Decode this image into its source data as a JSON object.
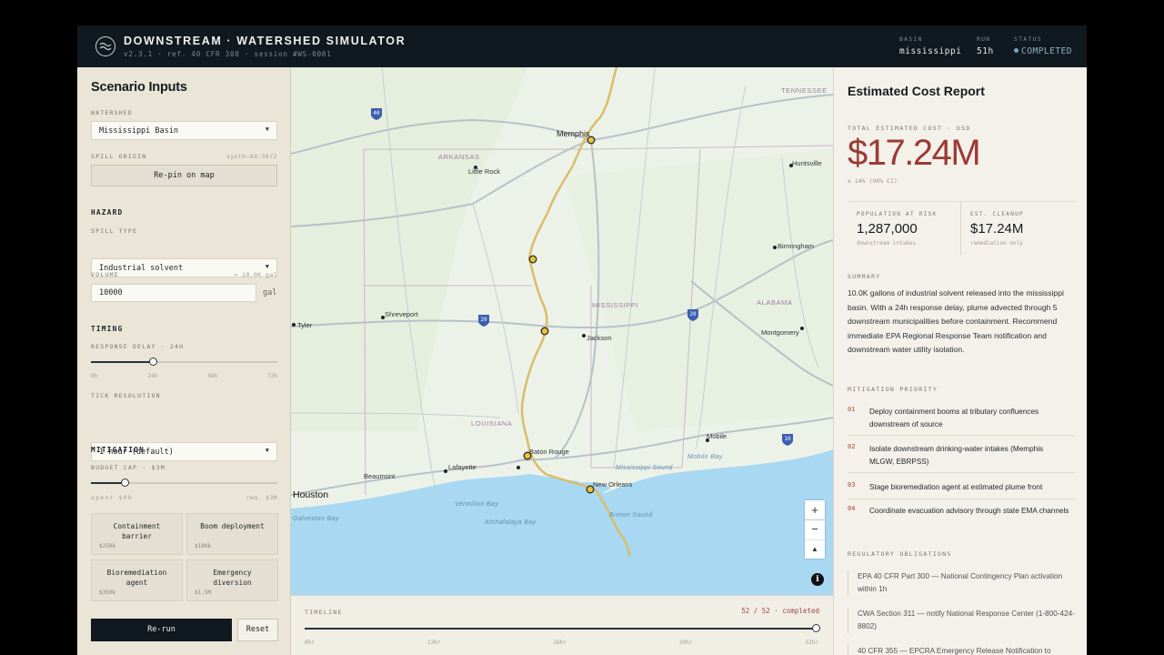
{
  "header": {
    "title": "DOWNSTREAM · WATERSHED SIMULATOR",
    "subtitle": "v2.3.1 · ref. 40 CFR 300 · session #WS-0001",
    "stats": [
      {
        "key": "BASIN",
        "value": "mississippi"
      },
      {
        "key": "RUN",
        "value": "51h"
      },
      {
        "key": "STATUS",
        "value": "COMPLETED"
      }
    ],
    "status_color": "#6fa7c0"
  },
  "inputs": {
    "title": "Scenario Inputs",
    "watershed_label": "WATERSHED",
    "watershed_value": "Mississippi Basin",
    "spill_origin_label": "SPILL ORIGIN",
    "spill_origin_hint": "synth—89.5672",
    "repin_label": "Re-pin on map",
    "hazard_section": "HAZARD",
    "spill_type_label": "SPILL TYPE",
    "spill_type_value": "Industrial solvent",
    "volume_label": "VOLUME",
    "volume_hint": "≈ 10.0K gal",
    "volume_value": "10000",
    "volume_unit": "gal",
    "timing_section": "TIMING",
    "response_delay_label": "RESPONSE DELAY · 24H",
    "response_delay_fraction": 0.333,
    "response_ticks": [
      "0h",
      "24h",
      "48h",
      "72h"
    ],
    "tick_res_label": "TICK RESOLUTION",
    "tick_res_value": "1 hour (default)",
    "mitigation_section": "MITIGATION",
    "budget_label": "BUDGET CAP · $3M",
    "budget_fraction": 0.18,
    "spent_label": "spent $0k",
    "remaining_label": "rem. $3M",
    "measures": [
      {
        "name": "Containment barrier",
        "price": "$250k"
      },
      {
        "name": "Boom deployment",
        "price": "$180k"
      },
      {
        "name": "Bioremediation agent",
        "price": "$350k"
      },
      {
        "name": "Emergency diversion",
        "price": "$1.5M"
      }
    ],
    "rerun_label": "Re-run",
    "reset_label": "Reset"
  },
  "map": {
    "states": [
      "TENNESSEE",
      "ARKANSAS",
      "MISSISSIPPI",
      "ALABAMA",
      "LOUISIANA"
    ],
    "cities": [
      "Memphis",
      "Little Rock",
      "Huntsville",
      "Birmingham",
      "Shreveport",
      "Tyler",
      "Jackson",
      "Montgomery",
      "Mobile",
      "Baton Rouge",
      "Lafayette",
      "Beaumont",
      "Houston",
      "New Orleans"
    ],
    "water": [
      "Mississippi Sound",
      "Mobile Bay",
      "Vermilion Bay",
      "Atchafalaya Bay",
      "Galveston Bay",
      "Breton Sound"
    ],
    "highways": [
      "40",
      "20",
      "20",
      "10"
    ],
    "zoom_in": "+",
    "zoom_out": "−",
    "reset_north": "▲",
    "info": "i",
    "river_color": "#d8bd6a",
    "water_color": "#a8d8f2"
  },
  "timeline": {
    "label": "TIMELINE",
    "progress_text": "52 / 52 · completed",
    "fraction": 1.0,
    "ticks": [
      "0hr",
      "13hr",
      "26hr",
      "39hr",
      "52hr"
    ]
  },
  "report": {
    "title": "Estimated Cost Report",
    "total_label": "TOTAL ESTIMATED COST · USD",
    "total_value": "$17.24M",
    "ci": "± 14% (90% CI)",
    "pop_label": "POPULATION AT RISK",
    "pop_value": "1,287,000",
    "pop_sub": "downstream intakes",
    "cleanup_label": "EST. CLEANUP",
    "cleanup_value": "$17.24M",
    "cleanup_sub": "remediation only",
    "summary_label": "SUMMARY",
    "summary": "10.0K gallons of industrial solvent released into the mississippi basin. With a 24h response delay, plume advected through 5 downstream municipalities before containment. Recommend immediate EPA Regional Response Team notification and downstream water utility isolation.",
    "priority_label": "MITIGATION PRIORITY",
    "priorities": [
      {
        "n": "01",
        "text": "Deploy containment booms at tributary confluences downstream of source"
      },
      {
        "n": "02",
        "text": "Isolate downstream drinking-water intakes (Memphis MLGW, EBRPSS)"
      },
      {
        "n": "03",
        "text": "Stage bioremediation agent at estimated plume front"
      },
      {
        "n": "04",
        "text": "Coordinate evacuation advisory through state EMA channels"
      }
    ],
    "obligations_label": "REGULATORY OBLIGATIONS",
    "obligations": [
      "EPA 40 CFR Part 300 — National Contingency Plan activation within 1h",
      "CWA Section 311 — notify National Response Center (1-800-424-8802)",
      "40 CFR 355 — EPCRA Emergency Release Notification to"
    ],
    "accent_color": "#9c3a34"
  }
}
